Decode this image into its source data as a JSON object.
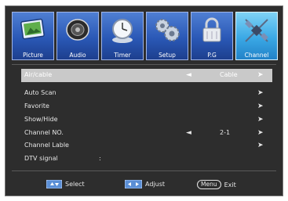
{
  "tabs": [
    {
      "label": "Picture",
      "icon": "picture-icon",
      "active": false
    },
    {
      "label": "Audio",
      "icon": "speaker-icon",
      "active": false
    },
    {
      "label": "Timer",
      "icon": "clock-icon",
      "active": false
    },
    {
      "label": "Setup",
      "icon": "gears-icon",
      "active": false
    },
    {
      "label": "P.G",
      "icon": "lock-icon",
      "active": false
    },
    {
      "label": "Channel",
      "icon": "satellite-icon",
      "active": true
    }
  ],
  "menu": {
    "air_cable": {
      "label": "Air/cable",
      "arrow_left": "◄",
      "value": "Cable",
      "arrow_right": "➤"
    },
    "auto_scan": {
      "label": "Auto  Scan",
      "arrow_right": "➤"
    },
    "favorite": {
      "label": "Favorite",
      "arrow_right": "➤"
    },
    "show_hide": {
      "label": "Show/Hide",
      "arrow_right": "➤"
    },
    "channel_no": {
      "label": "Channel NO.",
      "arrow_left": "◄",
      "value": "2-1",
      "arrow_right": "➤"
    },
    "channel_lable": {
      "label": "Channel Lable",
      "arrow_right": "➤"
    },
    "dtv_signal": {
      "label": "DTV signal",
      "colon": ":"
    }
  },
  "footer": {
    "select_label": "Select",
    "adjust_label": "Adjust",
    "menu_key": "Menu",
    "exit_label": "Exit"
  },
  "colors": {
    "tab_blue": "#2a58b6",
    "tab_active": "#3aa8e5",
    "selected_row": "#c9c9c9",
    "background": "#2d2d2d"
  }
}
